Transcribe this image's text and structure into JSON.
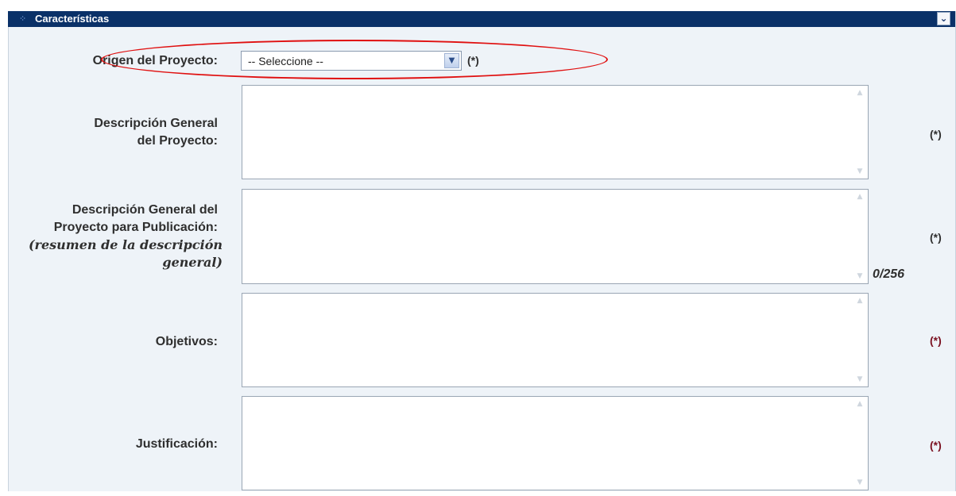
{
  "section": {
    "title": "Características",
    "collapse_icon": "double-chevron-down-icon",
    "header_color": "#0a3168",
    "panel_color": "#eef3f8"
  },
  "fields": {
    "origen": {
      "label": "Origen del Proyecto:",
      "select_value": "-- Seleccione --",
      "required": "(*)"
    },
    "descripcion": {
      "label_line1": "Descripción General",
      "label_line2": "del Proyecto:",
      "required": "(*)"
    },
    "publicacion": {
      "label_line1": "Descripción General del",
      "label_line2": "Proyecto para Publicación:",
      "note_line1": "(resumen de la descripción",
      "note_line2": "general)",
      "counter": "0/256",
      "required": "(*)"
    },
    "objetivos": {
      "label": "Objetivos:",
      "required": "(*)"
    },
    "justificacion": {
      "label": "Justificación:",
      "required": "(*)"
    }
  },
  "annotation": {
    "color": "#e01010"
  }
}
